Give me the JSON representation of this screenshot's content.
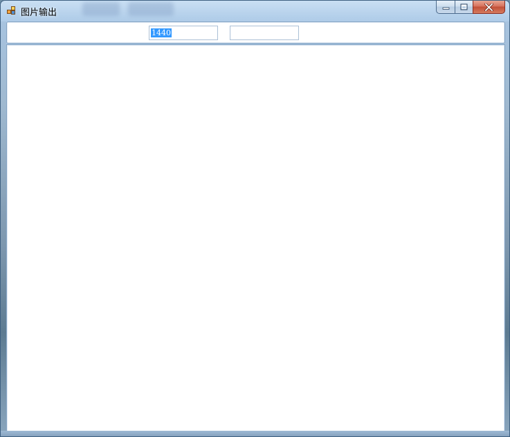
{
  "window": {
    "title": "图片输出",
    "icon": "app-window-icon"
  },
  "caption_buttons": {
    "minimize": "minimize-icon",
    "maximize": "maximize-icon",
    "close": "close-icon"
  },
  "toolbar": {
    "field1_value": "1440",
    "field2_value": ""
  },
  "colors": {
    "selection": "#3399ff",
    "close_button": "#c24f37",
    "frame": "#a9c6e4"
  }
}
